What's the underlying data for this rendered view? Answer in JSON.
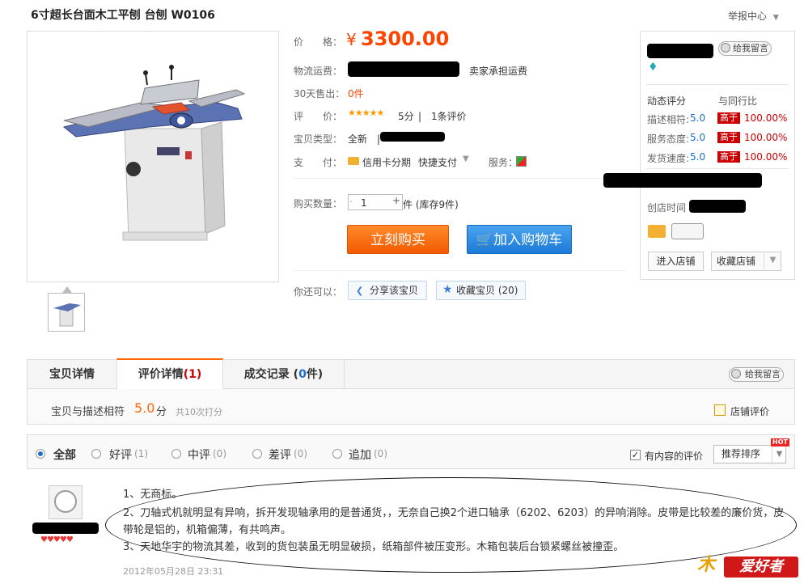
{
  "product": {
    "title": "6寸超长台面木工平刨 台刨 W0106",
    "report": "举报中心",
    "report_caret": "▼"
  },
  "info": {
    "price_label": "价　　格：",
    "currency": "¥",
    "price": "3300.00",
    "shipping_label": "物流运费：",
    "shipping_note": "卖家承担运费",
    "sold_label": "30天售出：",
    "sold_value": "0件",
    "rating_label": "评　　价：",
    "stars": "★★★★★",
    "rating_score": "5分",
    "rating_count": "|　1条评价",
    "type_label": "宝贝类型：",
    "type_value": "全新　|",
    "pay_label": "支　　付：",
    "pay_card": "信用卡分期",
    "pay_fast": "快捷支付",
    "pay_caret": "▼",
    "service_label": "服务：",
    "qty_label": "购买数量：",
    "qty_minus": "-",
    "qty_value": "1",
    "qty_plus": "+",
    "qty_stock": "件 (库存9件)",
    "buy_now": "立刻购买",
    "add_cart": "加入购物车",
    "can_label": "你还可以：",
    "share": "分享该宝贝",
    "fav": "收藏宝贝 (20)"
  },
  "shop": {
    "msg_btn": "给我留言",
    "dynamic_label": "动态评分",
    "compare_label": "与同行比",
    "rows": [
      {
        "label": "描述相符:",
        "score": "5.0",
        "tag": "高于",
        "pct": "100.00%"
      },
      {
        "label": "服务态度:",
        "score": "5.0",
        "tag": "高于",
        "pct": "100.00%"
      },
      {
        "label": "发货速度:",
        "score": "5.0",
        "tag": "高于",
        "pct": "100.00%"
      }
    ],
    "since_label": "创店时间",
    "enter": "进入店铺",
    "collect": "收藏店铺",
    "collect_caret": "▼"
  },
  "tabs": {
    "details": "宝贝详情",
    "reviews": "评价详情",
    "reviews_count": "(1)",
    "records": "成交记录",
    "records_count_open": "(",
    "records_count": "0",
    "records_count_close": "件)",
    "msg_btn": "给我留言"
  },
  "summary": {
    "text": "宝贝与描述相符",
    "score": "5.0",
    "unit": "分",
    "times": "共10次打分",
    "shop_rating": "店铺评价"
  },
  "filters": {
    "all": "全部",
    "good": "好评",
    "good_count": "(1)",
    "mid": "中评",
    "mid_count": "(0)",
    "bad": "差评",
    "bad_count": "(0)",
    "add": "追加",
    "add_count": "(0)",
    "has_content": "有内容的评价",
    "sort": "推荐排序",
    "sort_caret": "▼",
    "hot": "HOT",
    "check_mark": "✓"
  },
  "review": {
    "hearts": "♥♥♥♥♥",
    "line1": "1、无商标。",
    "line2": "2、刀轴式机就明显有异响，拆开发现轴承用的是普通货，，无奈自己换2个进口轴承（6202、6203）的异响消除。皮带是比较差的廉价货，皮带轮是铝的，机箱偏薄，有共鸣声。",
    "line3": "3、天地华宇的物流其差，收到的货包装虽无明显破损，纸箱部件被压变形。木箱包装后台锁紧螺丝被撞歪。",
    "date": "2012年05月28日 23:31"
  },
  "watermark": {
    "a": "木",
    "b": "爱好者"
  },
  "colors": {
    "price": "#ff4400",
    "buy": "#f35a00",
    "cart": "#1c7bd7",
    "tag": "#cc0000"
  }
}
